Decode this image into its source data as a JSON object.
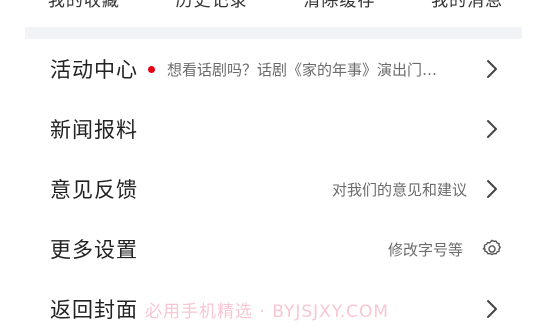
{
  "quick_links": [
    {
      "label": "我的收藏"
    },
    {
      "label": "历史记录"
    },
    {
      "label": "清除缓存"
    },
    {
      "label": "我的消息"
    }
  ],
  "menu": {
    "activity": {
      "label": "活动中心",
      "description": "想看话剧吗？话剧《家的年事》演出门…",
      "badge_color": "#e60012"
    },
    "news_tip": {
      "label": "新闻报料"
    },
    "feedback": {
      "label": "意见反馈",
      "description": "对我们的意见和建议"
    },
    "settings": {
      "label": "更多设置",
      "description": "修改字号等",
      "icon": "gear-icon"
    },
    "back_cover": {
      "label": "返回封面"
    }
  },
  "watermark": "必用手机精选 · BYJSJXY.COM",
  "colors": {
    "text": "#222222",
    "secondary": "#6b6b6b",
    "band": "#f1f3f6",
    "badge": "#e60012"
  }
}
